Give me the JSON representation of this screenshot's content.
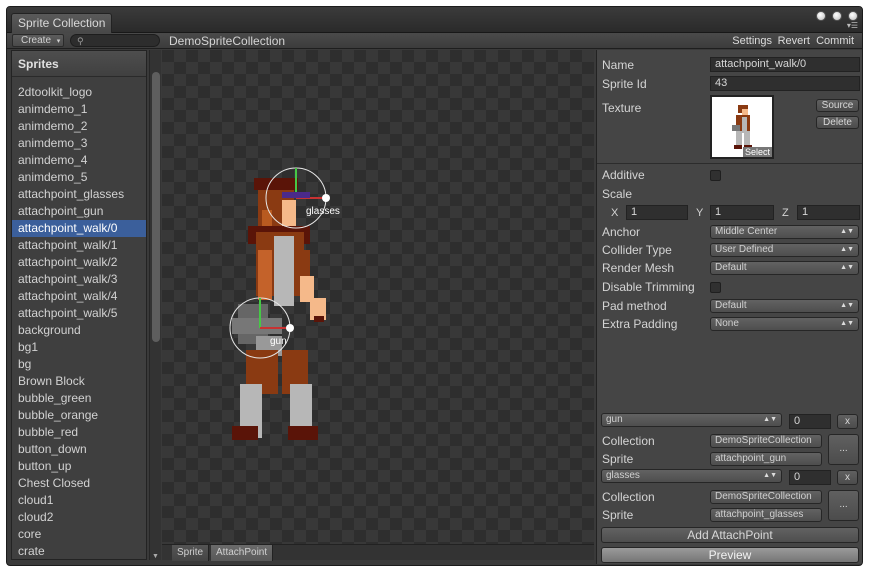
{
  "window": {
    "tab_title": "Sprite Collection"
  },
  "toolbar": {
    "create_label": "Create",
    "collection_name": "DemoSpriteCollection",
    "settings_label": "Settings",
    "revert_label": "Revert",
    "commit_label": "Commit"
  },
  "sidebar": {
    "header": "Sprites",
    "items": [
      "2dtoolkit_logo",
      "animdemo_1",
      "animdemo_2",
      "animdemo_3",
      "animdemo_4",
      "animdemo_5",
      "attachpoint_glasses",
      "attachpoint_gun",
      "attachpoint_walk/0",
      "attachpoint_walk/1",
      "attachpoint_walk/2",
      "attachpoint_walk/3",
      "attachpoint_walk/4",
      "attachpoint_walk/5",
      "background",
      "bg1",
      "bg",
      "Brown Block",
      "bubble_green",
      "bubble_orange",
      "bubble_red",
      "button_down",
      "button_up",
      "Chest Closed",
      "cloud1",
      "cloud2",
      "core",
      "crate"
    ],
    "selected_index": 8
  },
  "preview": {
    "attach_labels": {
      "glasses": "glasses",
      "gun": "gun"
    },
    "tabs": [
      "Sprite",
      "AttachPoint"
    ],
    "active_tab": 1
  },
  "inspector": {
    "name_label": "Name",
    "name_value": "attachpoint_walk/0",
    "sprite_id_label": "Sprite Id",
    "sprite_id_value": "43",
    "texture_label": "Texture",
    "texture_select": "Select",
    "source_label": "Source",
    "delete_label": "Delete",
    "additive_label": "Additive",
    "scale_label": "Scale",
    "scale": {
      "x_label": "X",
      "x": "1",
      "y_label": "Y",
      "y": "1",
      "z_label": "Z",
      "z": "1"
    },
    "anchor_label": "Anchor",
    "anchor_value": "Middle Center",
    "collider_label": "Collider Type",
    "collider_value": "User Defined",
    "render_mesh_label": "Render Mesh",
    "render_mesh_value": "Default",
    "disable_trimming_label": "Disable Trimming",
    "pad_method_label": "Pad method",
    "pad_method_value": "Default",
    "extra_padding_label": "Extra Padding",
    "extra_padding_value": "None"
  },
  "attachpoints": [
    {
      "name": "gun",
      "angle": "0",
      "remove": "x",
      "collection_label": "Collection",
      "collection_value": "DemoSpriteCollection",
      "sprite_label": "Sprite",
      "sprite_value": "attachpoint_gun",
      "more": "..."
    },
    {
      "name": "glasses",
      "angle": "0",
      "remove": "x",
      "collection_label": "Collection",
      "collection_value": "DemoSpriteCollection",
      "sprite_label": "Sprite",
      "sprite_value": "attachpoint_glasses",
      "more": "..."
    }
  ],
  "actions": {
    "add_attachpoint": "Add AttachPoint",
    "preview": "Preview"
  }
}
